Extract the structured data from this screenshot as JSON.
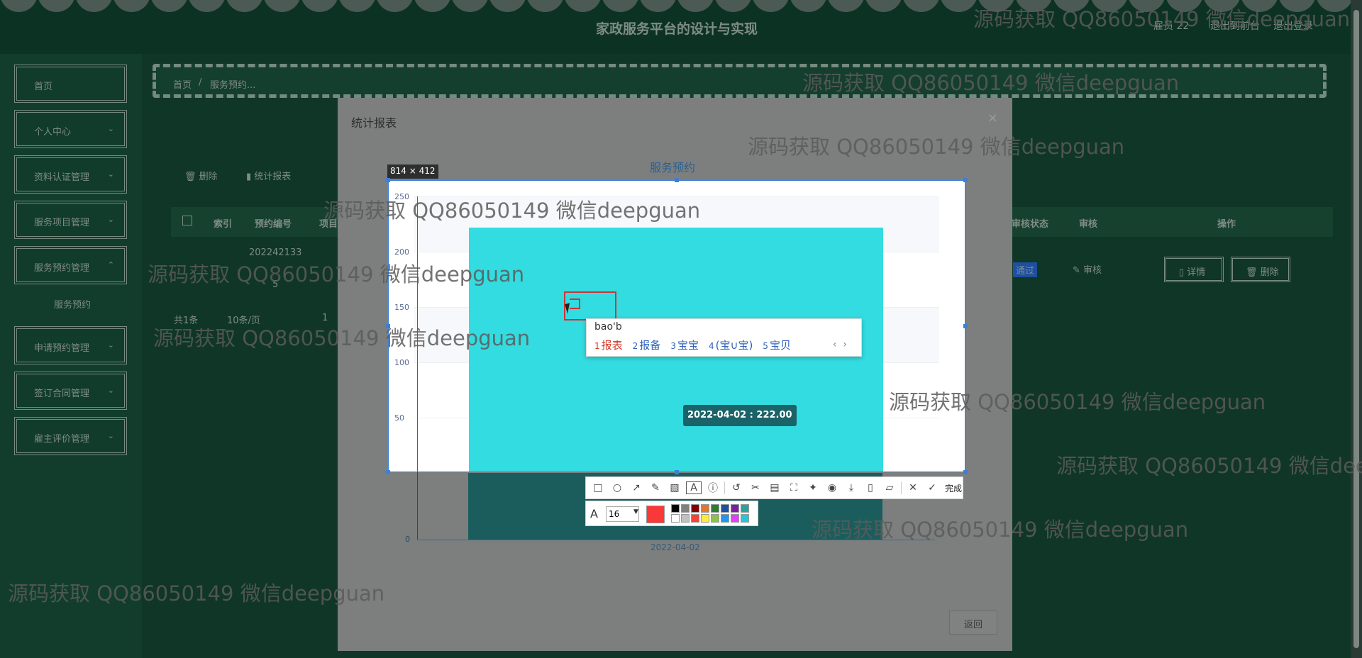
{
  "header": {
    "site_title": "家政服务平台的设计与实现",
    "user_label": "雇员 22",
    "exit_to_admin": "退出到前台",
    "logout": "退出登录"
  },
  "sidebar": {
    "items": [
      {
        "label": "首页",
        "has_children": false
      },
      {
        "label": "个人中心",
        "has_children": true
      },
      {
        "label": "资料认证管理",
        "has_children": true
      },
      {
        "label": "服务项目管理",
        "has_children": true
      },
      {
        "label": "服务预约管理",
        "has_children": true
      },
      {
        "label": "申请预约管理",
        "has_children": true
      },
      {
        "label": "签订合同管理",
        "has_children": true
      },
      {
        "label": "雇主评价管理",
        "has_children": true
      }
    ],
    "submenu_label": "服务预约"
  },
  "breadcrumb": {
    "home": "首页",
    "separator": "/",
    "current": "服务预约..."
  },
  "toolbar": {
    "delete_label": "删除",
    "stats_label": "统计报表"
  },
  "table": {
    "headers": [
      "索引",
      "预约编号",
      "项目",
      "审核状态",
      "审核",
      "操作"
    ],
    "row": {
      "order_no_line1": "202242133",
      "order_no_line2": "5",
      "audit_status": "通过",
      "audit_link": "审核",
      "detail_button": "详情",
      "delete_button": "删除"
    },
    "pagination": {
      "total": "共1条",
      "per_page": "10条/页",
      "page": "1"
    }
  },
  "modal": {
    "title": "统计报表",
    "close_icon": "×",
    "chart_title": "服务预约",
    "return_button": "返回"
  },
  "chart_data": {
    "type": "bar",
    "title": "服务预约",
    "categories": [
      "2022-04-02"
    ],
    "values": [
      222.0
    ],
    "ylim": [
      0,
      250
    ],
    "y_ticks": [
      "250",
      "200",
      "150",
      "100",
      "50",
      "0"
    ],
    "tooltip": "2022-04-02 : 222.00",
    "grid": true
  },
  "screenshot_tool": {
    "selection_size": "814 × 412",
    "ime_input": "bao'b",
    "ime_candidates": [
      {
        "index": "1",
        "text": "报表"
      },
      {
        "index": "2",
        "text": "报备"
      },
      {
        "index": "3",
        "text": "宝宝"
      },
      {
        "index": "4",
        "text": "(宝∪宝)"
      },
      {
        "index": "5",
        "text": "宝贝"
      }
    ],
    "ime_prev": "‹",
    "ime_next": "›",
    "done_label": "完成",
    "font_size": "16",
    "current_color": "#f93838",
    "palette": [
      "#000000",
      "#808080",
      "#800000",
      "#e07830",
      "#2e7d32",
      "#1e4fa0",
      "#7b1fa2",
      "#26a69a",
      "#ffffff",
      "#c0c0c0",
      "#f44336",
      "#ffeb3b",
      "#8bc34a",
      "#2196f3",
      "#e040fb",
      "#26c6da"
    ]
  },
  "watermarks": [
    "源码获取 QQ86050149 微信deepguan",
    "源码获取 QQ86050149 微信deepguan",
    "源码获取 QQ86050149 微信deepguan",
    "源码获取 QQ86050149 微信deepguan",
    "源码获取 QQ86050149 微信deepguan",
    "源码获取 QQ86050149 微信deepguan",
    "源码获取 QQ86050149 微信deepguan",
    "源码获取 QQ86050149 微信deepguan",
    "源码获取 QQ86050149 微信deepguan",
    "源码获取 QQ86050149 微信deepguan"
  ]
}
